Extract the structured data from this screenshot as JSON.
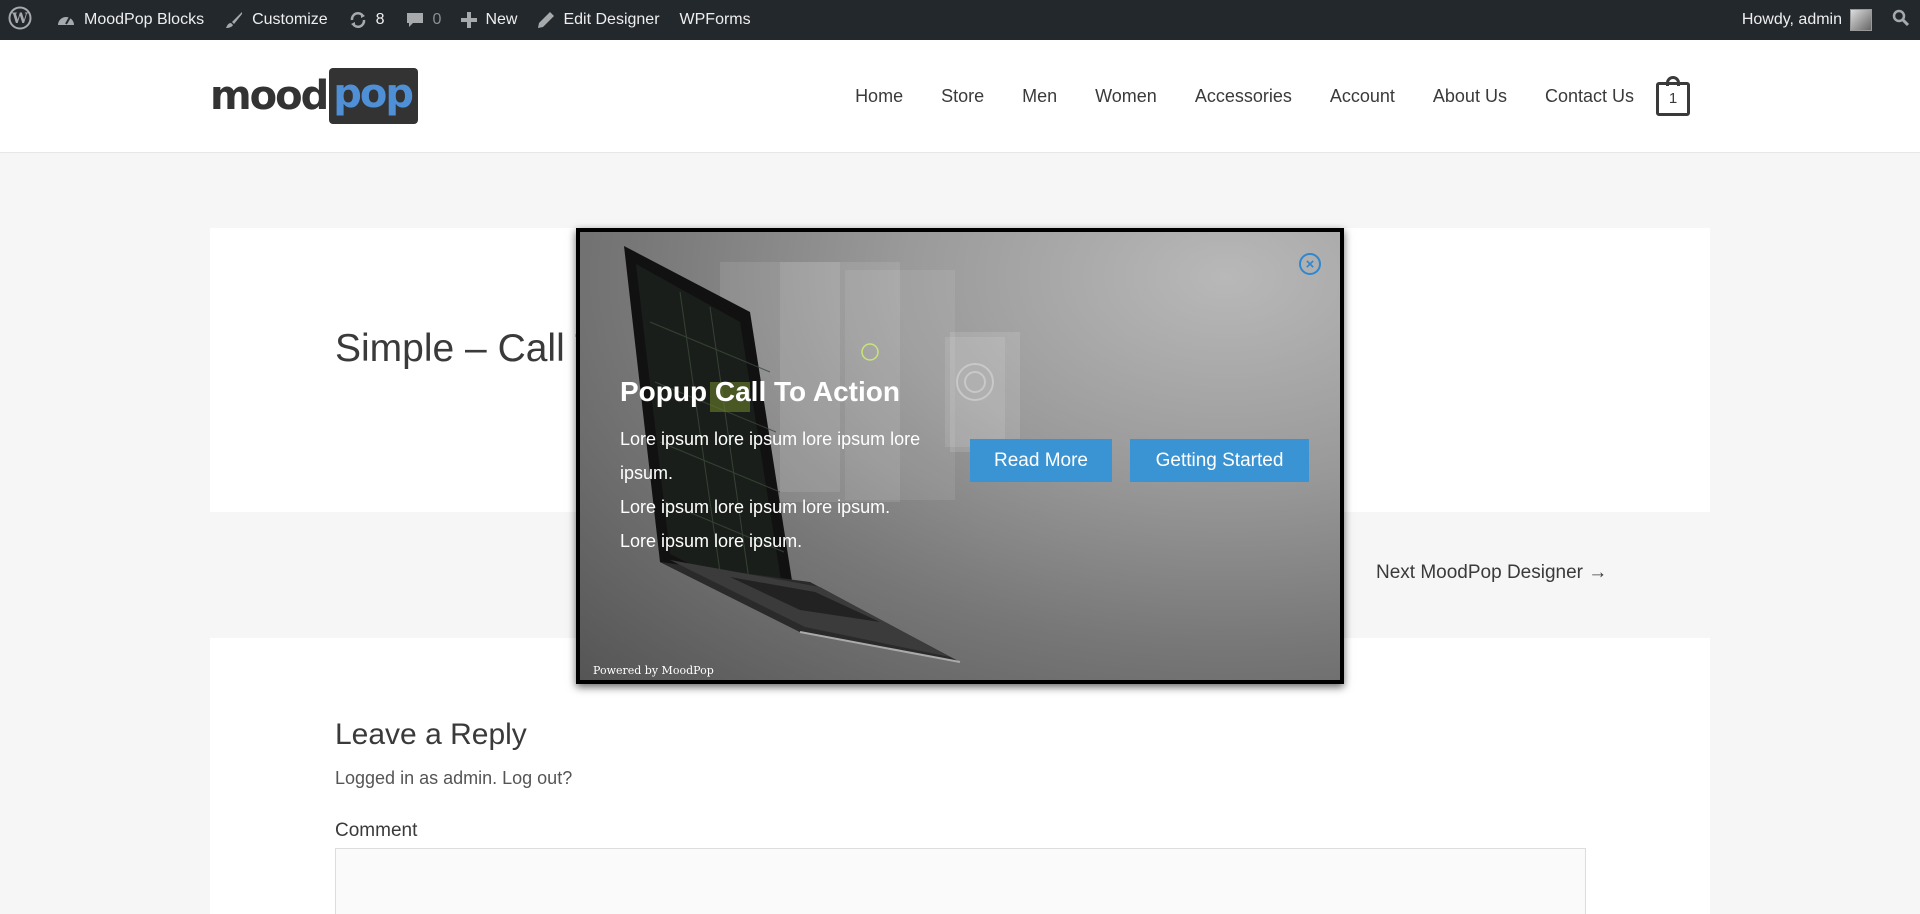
{
  "adminbar": {
    "site_name": "MoodPop Blocks",
    "customize": "Customize",
    "updates_count": "8",
    "comments_count": "0",
    "new": "New",
    "edit_designer": "Edit Designer",
    "wpforms": "WPForms",
    "howdy": "Howdy, admin"
  },
  "header": {
    "logo_left": "mood",
    "logo_right": "pop",
    "nav": [
      "Home",
      "Store",
      "Men",
      "Women",
      "Accessories",
      "Account",
      "About Us",
      "Contact Us"
    ],
    "cart_count": "1"
  },
  "post": {
    "title": "Simple – Call To"
  },
  "post_nav": {
    "next": "Next MoodPop Designer →"
  },
  "reply": {
    "title": "Leave a Reply",
    "logged_in": "Logged in as admin.",
    "logout": "Log out?",
    "comment_label": "Comment"
  },
  "popup": {
    "title": "Popup Call To Action",
    "lines": [
      "Lore ipsum lore ipsum lore ipsum lore ipsum.",
      "Lore ipsum lore ipsum lore ipsum.",
      "Lore ipsum lore ipsum."
    ],
    "read_more": "Read More",
    "getting_started": "Getting Started",
    "powered_by": "Powered by MoodPop"
  },
  "colors": {
    "adminbar_bg": "#23282d",
    "button_blue": "#3a93d3",
    "close_blue": "#2f87cf",
    "logo_blue": "#4f8fd6"
  }
}
